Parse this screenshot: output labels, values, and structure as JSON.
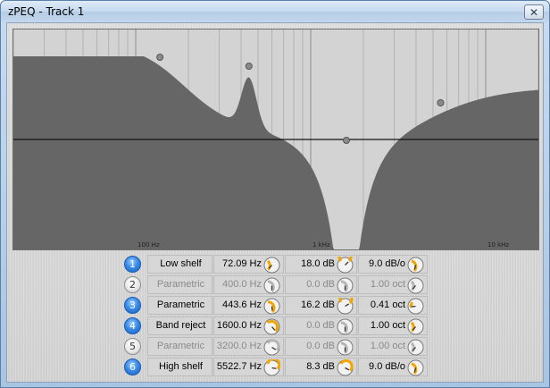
{
  "window": {
    "title": "zPEQ - Track 1",
    "close_glyph": "✕"
  },
  "graph": {
    "freq_labels": [
      "100 Hz",
      "1 kHz",
      "10 kHz"
    ],
    "freq_min_hz": 20,
    "freq_max_hz": 20000,
    "fill_color": "#666666",
    "background_color": "#d3d3d3",
    "zero_line_color": "#111111"
  },
  "bands": [
    {
      "number": "1",
      "enabled": true,
      "type": "Low shelf",
      "freq": "72.09 Hz",
      "gain": "18.0 dB",
      "q": "9.0 dB/o",
      "freq_knob": 0.35,
      "gain_knob": 1.0,
      "q_knob": 0.45
    },
    {
      "number": "2",
      "enabled": false,
      "type": "Parametric",
      "freq": "400.0 Hz",
      "gain": "0.0 dB",
      "q": "1.00 oct",
      "freq_knob": 0.5,
      "gain_knob": 0.5,
      "q_knob": 0.35
    },
    {
      "number": "3",
      "enabled": true,
      "type": "Parametric",
      "freq": "443.6 Hz",
      "gain": "16.2 dB",
      "q": "0.41 oct",
      "freq_knob": 0.52,
      "gain_knob": 0.95,
      "q_knob": 0.2
    },
    {
      "number": "4",
      "enabled": true,
      "type": "Band reject",
      "freq": "1600.0 Hz",
      "gain": "0.0 dB",
      "q": "1.00 oct",
      "freq_knob": 0.65,
      "gain_knob": 0.5,
      "q_knob": 0.35
    },
    {
      "number": "5",
      "enabled": false,
      "type": "Parametric",
      "freq": "3200.0 Hz",
      "gain": "0.0 dB",
      "q": "1.00 oct",
      "freq_knob": 0.72,
      "gain_knob": 0.5,
      "q_knob": 0.35
    },
    {
      "number": "6",
      "enabled": true,
      "type": "High shelf",
      "freq": "5522.7 Hz",
      "gain": "8.3 dB",
      "q": "9.0 dB/o",
      "freq_knob": 0.8,
      "gain_knob": 0.73,
      "q_knob": 0.45
    }
  ],
  "colors": {
    "knob_accent": "#f0a500",
    "band_on": "#3a8be6"
  }
}
